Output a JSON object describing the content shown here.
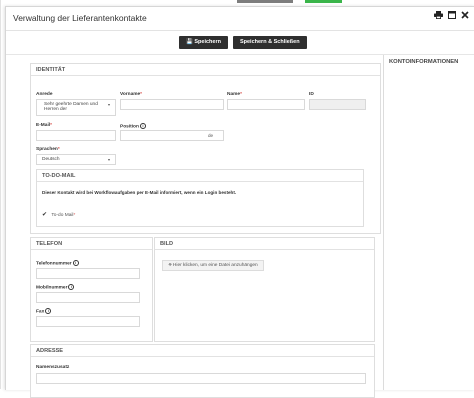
{
  "window": {
    "title": "Verwaltung der Lieferantenkontakte",
    "icons": [
      "print-icon",
      "maximize-icon",
      "close-icon"
    ]
  },
  "toolbar": {
    "save_label": "💾 Speichern",
    "save_close_label": "Speichern & Schließen"
  },
  "sidebar": {
    "heading": "KONTOINFORMATIONEN"
  },
  "identity": {
    "heading": "IDENTITÄT",
    "anrede_label": "Anrede",
    "anrede_value": "Sehr geehrte Damen und Herren der",
    "vorname_label": "Vorname",
    "name_label": "Name",
    "id_label": "ID",
    "email_label": "E-Mail",
    "position_label": "Position",
    "position_suffix": "de",
    "sprachen_label": "Sprachen",
    "sprachen_value": "Deutsch"
  },
  "todo": {
    "heading": "TO-DO-MAIL",
    "message": "Dieser Kontakt wird bei Workflowaufgaben per E-Mail informiert, wenn ein Login besteht.",
    "checkbox_label": "To-do Mail"
  },
  "telefon": {
    "heading": "TELEFON",
    "telefonnummer_label": "Telefonnummer",
    "mobilnummer_label": "Mobilnummer",
    "fax_label": "Fax"
  },
  "bild": {
    "heading": "BILD",
    "attach_label": "Hier klicken, um eine Datei anzuhängen"
  },
  "adresse": {
    "heading": "ADRESSE",
    "namenszusatz_label": "Namenszusatz"
  },
  "colors": {
    "button_bg": "#2f2f2f",
    "required": "#d9534f",
    "top_strip_gray": "#7d7d7d",
    "top_strip_green": "#3ab54a"
  }
}
